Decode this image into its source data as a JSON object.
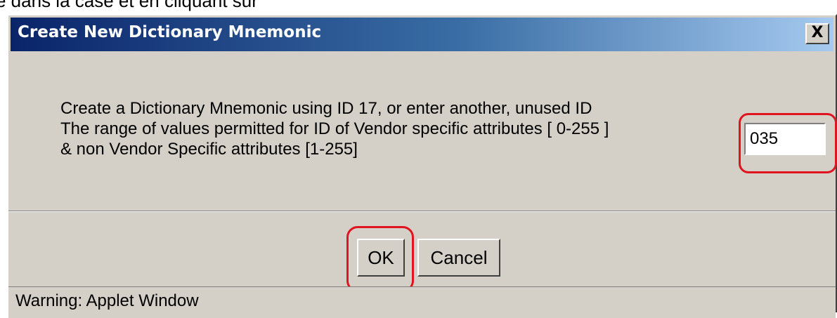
{
  "page": {
    "top_text": "e dans la case et en cliquant sur"
  },
  "dialog": {
    "title": "Create New Dictionary Mnemonic",
    "close_label": "X",
    "message_lines": [
      "Create a Dictionary Mnemonic using ID 17, or enter another, unused ID",
      "The range of values permitted for ID of  Vendor specific attributes [ 0-255 ]",
      "& non Vendor Specific attributes [1-255]"
    ],
    "id_input_value": "035",
    "ok_label": "OK",
    "cancel_label": "Cancel",
    "status_text": "Warning: Applet Window"
  },
  "colors": {
    "titlebar_start": "#0a246a",
    "titlebar_end": "#a6caf0",
    "dialog_bg": "#d4d0c8",
    "highlight": "#e0141e"
  },
  "icons": {
    "close": "close-icon"
  }
}
